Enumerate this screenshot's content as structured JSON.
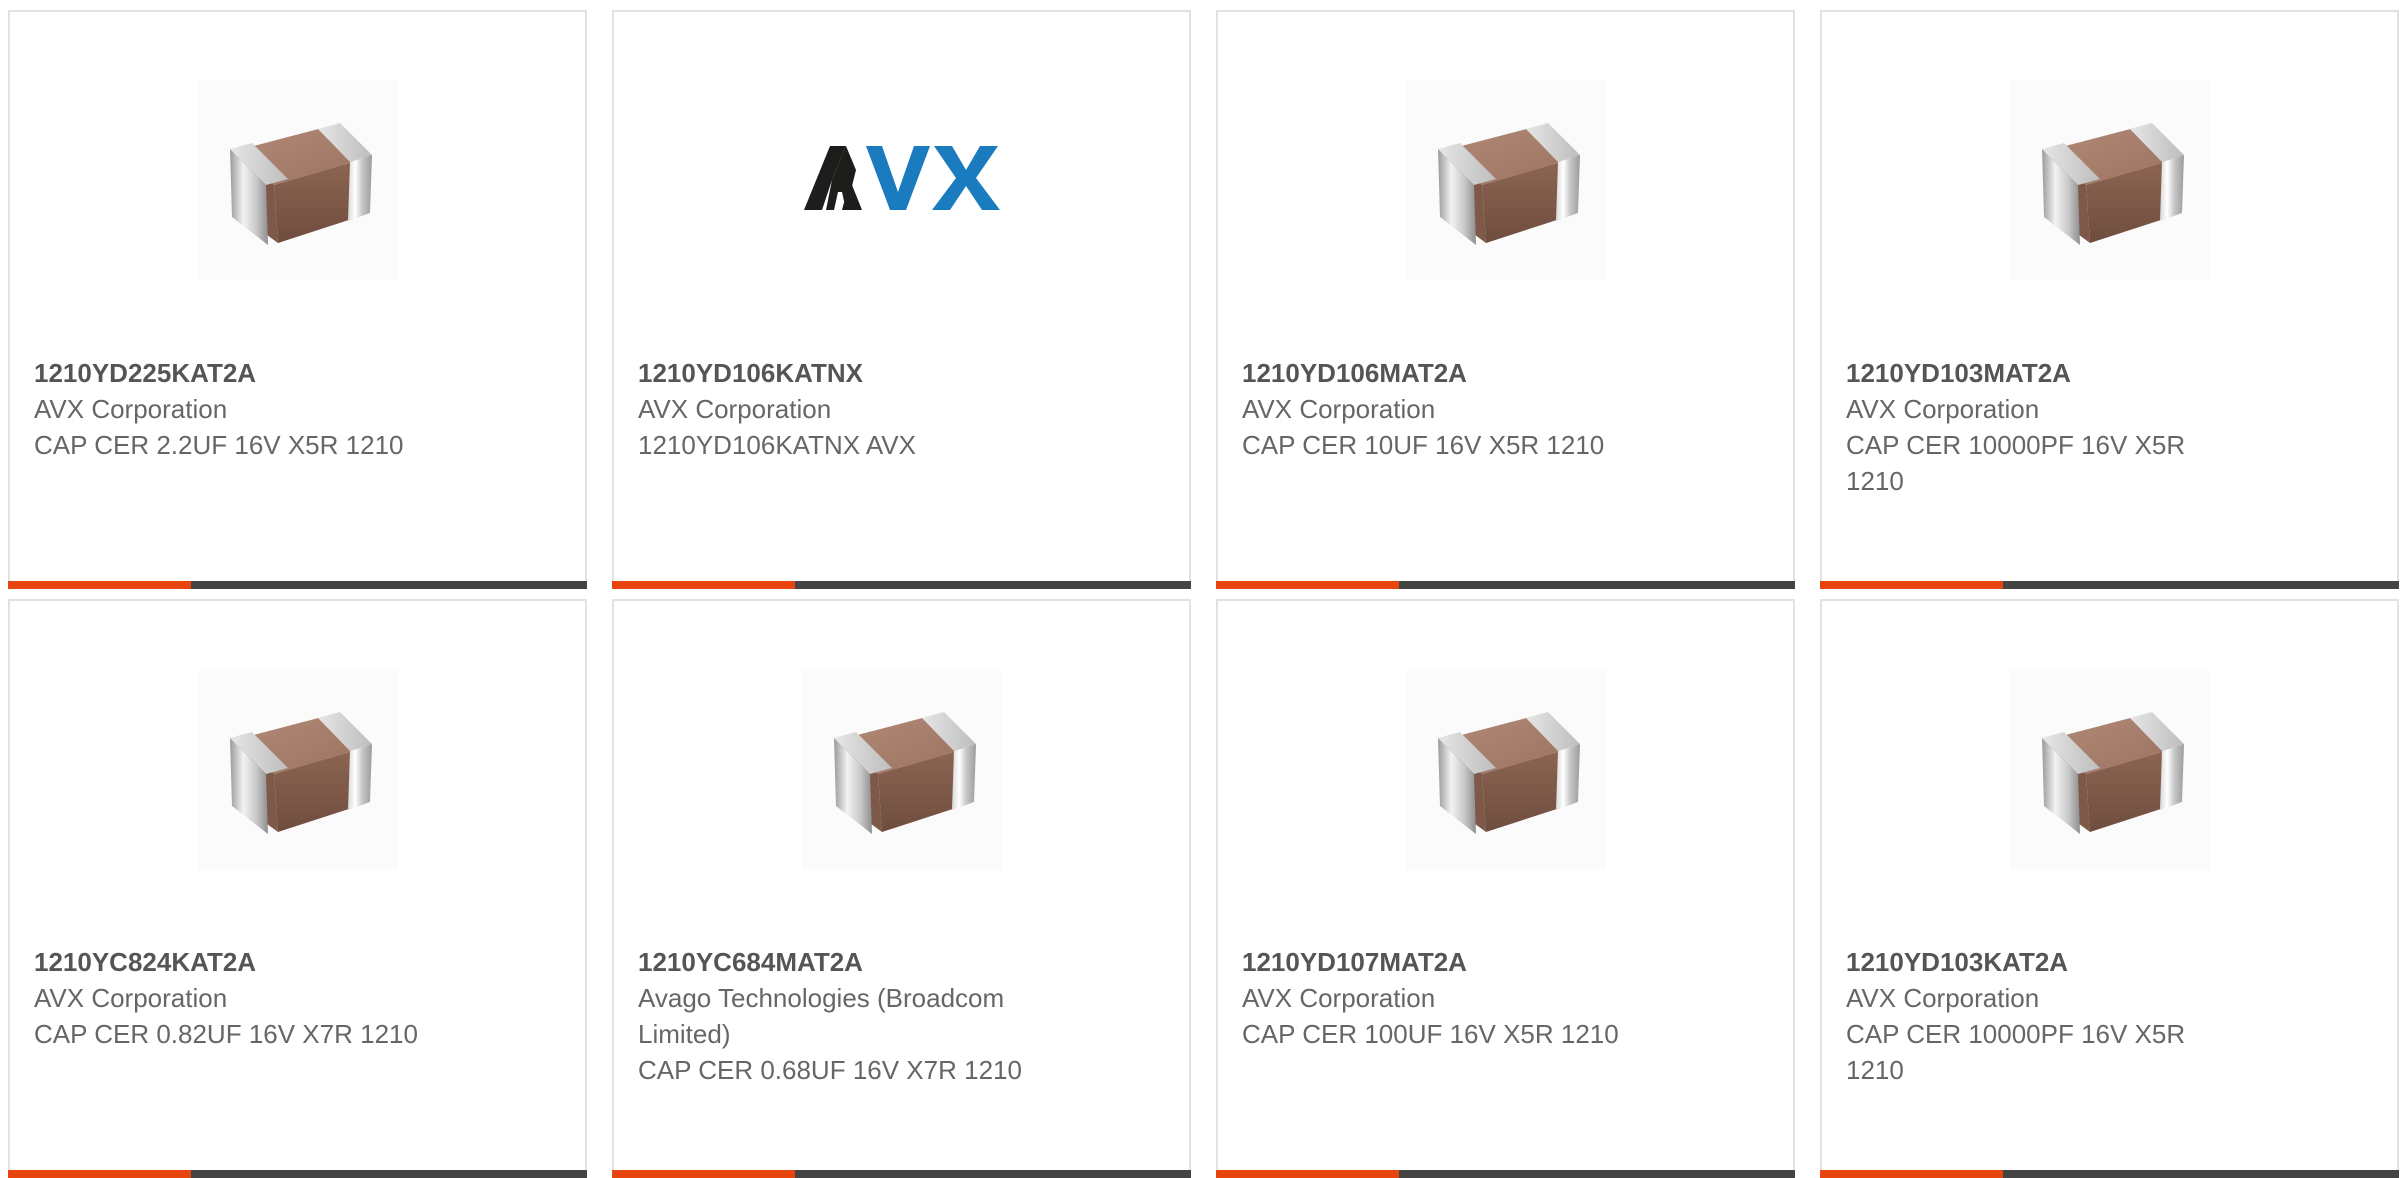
{
  "colors": {
    "accent": "#e8450e",
    "bar": "#444444",
    "border": "#e2e2e2",
    "text": "#666666",
    "avx_dark": "#1d1d1b",
    "avx_blue": "#1a7bbf"
  },
  "products": [
    {
      "part_number": "1210YD225KAT2A",
      "manufacturer": "AVX Corporation",
      "description": "CAP CER 2.2UF 16V X5R 1210",
      "image": "capacitor-chip"
    },
    {
      "part_number": "1210YD106KATNX",
      "manufacturer": "AVX Corporation",
      "description": "1210YD106KATNX AVX",
      "image": "avx-logo"
    },
    {
      "part_number": "1210YD106MAT2A",
      "manufacturer": "AVX Corporation",
      "description": "CAP CER 10UF 16V X5R 1210",
      "image": "capacitor-chip"
    },
    {
      "part_number": "1210YD103MAT2A",
      "manufacturer": "AVX Corporation",
      "description": "CAP CER 10000PF 16V X5R 1210",
      "image": "capacitor-chip"
    },
    {
      "part_number": "1210YC824KAT2A",
      "manufacturer": "AVX Corporation",
      "description": "CAP CER 0.82UF 16V X7R 1210",
      "image": "capacitor-chip"
    },
    {
      "part_number": "1210YC684MAT2A",
      "manufacturer": "Avago Technologies (Broadcom Limited)",
      "description": "CAP CER 0.68UF 16V X7R 1210",
      "image": "capacitor-chip"
    },
    {
      "part_number": "1210YD107MAT2A",
      "manufacturer": "AVX Corporation",
      "description": "CAP CER 100UF 16V X5R 1210",
      "image": "capacitor-chip"
    },
    {
      "part_number": "1210YD103KAT2A",
      "manufacturer": "AVX Corporation",
      "description": "CAP CER 10000PF 16V X5R 1210",
      "image": "capacitor-chip"
    }
  ]
}
